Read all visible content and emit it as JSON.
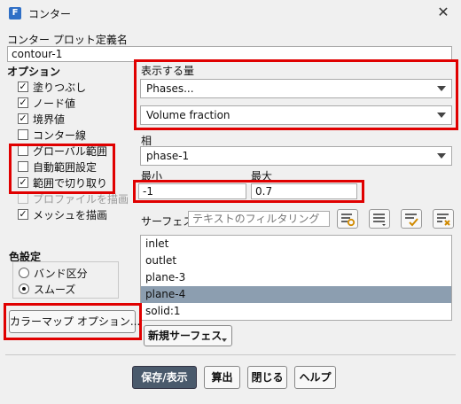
{
  "window": {
    "title": "コンター",
    "app_icon": "F"
  },
  "name_section": {
    "label": "コンター プロット定義名",
    "value": "contour-1"
  },
  "options": {
    "label": "オプション",
    "items": [
      {
        "label": "塗りつぶし",
        "checked": true,
        "enabled": true
      },
      {
        "label": "ノード値",
        "checked": true,
        "enabled": true
      },
      {
        "label": "境界値",
        "checked": true,
        "enabled": true
      },
      {
        "label": "コンター線",
        "checked": false,
        "enabled": true
      },
      {
        "label": "グローバル範囲",
        "checked": false,
        "enabled": true
      },
      {
        "label": "自動範囲設定",
        "checked": false,
        "enabled": true
      },
      {
        "label": "範囲で切り取り",
        "checked": true,
        "enabled": true
      },
      {
        "label": "プロファイルを描画",
        "checked": false,
        "enabled": false
      },
      {
        "label": "メッシュを描画",
        "checked": true,
        "enabled": true
      }
    ]
  },
  "display_quantity": {
    "label": "表示する量",
    "category": "Phases...",
    "variable": "Volume fraction"
  },
  "phase": {
    "label": "相",
    "value": "phase-1"
  },
  "range": {
    "min_label": "最小",
    "max_label": "最大",
    "min_value": "-1",
    "max_value": "0.7"
  },
  "surfaces": {
    "label": "サーフェス",
    "filter_placeholder": "テキストのフィルタリング",
    "items": [
      {
        "label": "inlet",
        "selected": false
      },
      {
        "label": "outlet",
        "selected": false
      },
      {
        "label": "plane-3",
        "selected": false
      },
      {
        "label": "plane-4",
        "selected": true
      },
      {
        "label": "solid:1",
        "selected": false
      }
    ],
    "new_surface_label": "新規サーフェス"
  },
  "color_settings": {
    "label": "色設定",
    "options": [
      {
        "label": "バンド区分",
        "selected": false
      },
      {
        "label": "スムーズ",
        "selected": true
      }
    ],
    "colormap_button": "カラーマップ オプション..."
  },
  "footer": {
    "save_display": "保存/表示",
    "compute": "算出",
    "close": "閉じる",
    "help": "ヘルプ"
  },
  "colors": {
    "highlight": "#e00000",
    "selected_row": "#8c9eb0",
    "primary_button": "#4a5a6c"
  }
}
